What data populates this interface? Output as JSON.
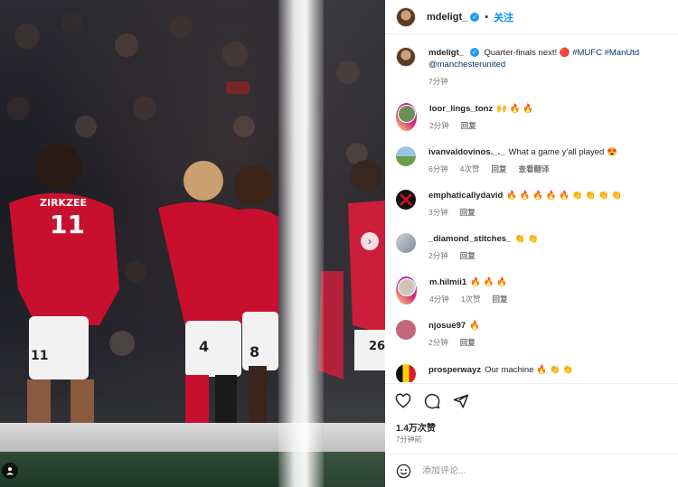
{
  "header": {
    "username": "mdeligt_",
    "separator": "•",
    "follow_label": "关注"
  },
  "caption": {
    "username": "mdeligt_",
    "text": "Quarter-finals next! 🔴",
    "hashtags": "#MUFC #ManUtd",
    "mention": "@manchesterunited",
    "time": "7分钟"
  },
  "comments": [
    {
      "username": "loor_lings_tonz",
      "text": "🙌 🔥 🔥",
      "time": "2分钟",
      "likes": "",
      "reply": "回复",
      "translate": ""
    },
    {
      "username": "ivanvaldovinos._._",
      "text": "What a game y'all played 😍",
      "time": "6分钟",
      "likes": "4次赞",
      "reply": "回复",
      "translate": "查看翻译"
    },
    {
      "username": "emphaticallydavid",
      "text": "🔥 🔥 🔥 🔥 🔥 👏 👏 👏 👏",
      "time": "3分钟",
      "likes": "",
      "reply": "回复",
      "translate": ""
    },
    {
      "username": "_diamond_stitches_",
      "text": "👏 👏",
      "time": "2分钟",
      "likes": "",
      "reply": "回复",
      "translate": ""
    },
    {
      "username": "m.hilmii1",
      "text": "🔥 🔥 🔥",
      "time": "4分钟",
      "likes": "1次赞",
      "reply": "回复",
      "translate": ""
    },
    {
      "username": "njosue97",
      "text": "🔥",
      "time": "2分钟",
      "likes": "",
      "reply": "回复",
      "translate": ""
    },
    {
      "username": "prosperwayz",
      "text": "Our machine 🔥 👏 👏",
      "time": "",
      "likes": "",
      "reply": "",
      "translate": ""
    }
  ],
  "post": {
    "likes": "1.4万次赞",
    "time_ago": "7分钟前"
  },
  "comment_input": {
    "placeholder": "添加评论..."
  },
  "photo": {
    "numbers": [
      "11",
      "ZIRKZEE",
      "4",
      "8",
      "11",
      "26"
    ]
  },
  "colors": {
    "accent": "#0095f6",
    "verified": "#1d9bf0",
    "jersey": "#c8102e"
  },
  "icons": [
    "heart-icon",
    "comment-icon",
    "share-icon",
    "emoji-icon",
    "next-arrow-icon",
    "tag-user-icon",
    "verified-badge-icon"
  ]
}
